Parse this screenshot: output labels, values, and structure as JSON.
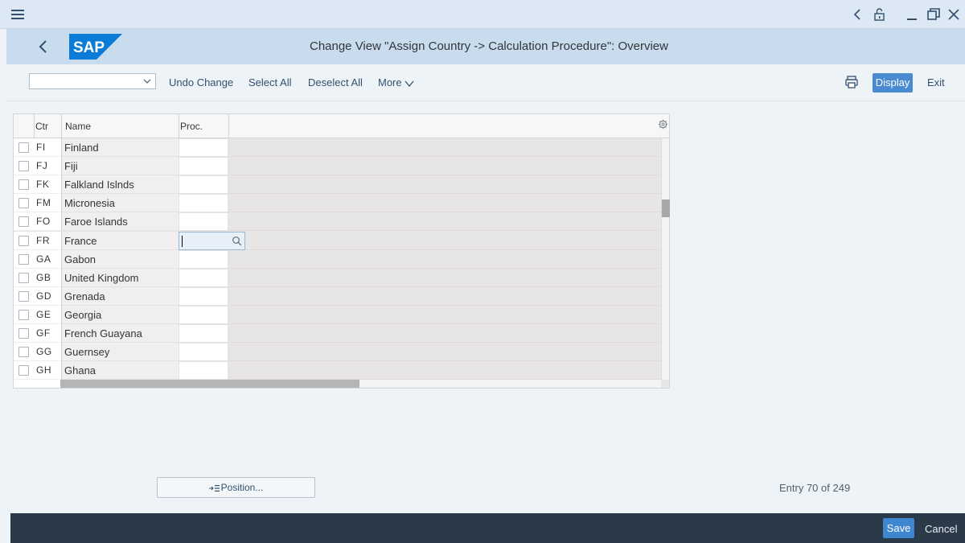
{
  "window": {
    "title": "Change View \"Assign Country -> Calculation Procedure\": Overview"
  },
  "brand": {
    "logo_text": "SAP",
    "logo_color": "#0a7bd6"
  },
  "colors": {
    "display_button": "#4a8ad0",
    "save_button": "#3f86d0",
    "footer": "#2b3a48",
    "title_bar": "#c8dcee"
  },
  "toolbar": {
    "select_value": "",
    "undo_change": "Undo Change",
    "select_all": "Select All",
    "deselect_all": "Deselect All",
    "more": "More",
    "display": "Display",
    "exit": "Exit"
  },
  "table": {
    "headers": {
      "ctr": "Ctr",
      "name": "Name",
      "proc": "Proc."
    },
    "rows": [
      {
        "ctr": "FI",
        "name": "Finland",
        "proc": ""
      },
      {
        "ctr": "FJ",
        "name": "Fiji",
        "proc": ""
      },
      {
        "ctr": "FK",
        "name": "Falkland Islnds",
        "proc": ""
      },
      {
        "ctr": "FM",
        "name": "Micronesia",
        "proc": ""
      },
      {
        "ctr": "FO",
        "name": "Faroe Islands",
        "proc": ""
      },
      {
        "ctr": "FR",
        "name": "France",
        "proc": "",
        "active": true
      },
      {
        "ctr": "GA",
        "name": "Gabon",
        "proc": ""
      },
      {
        "ctr": "GB",
        "name": "United Kingdom",
        "proc": ""
      },
      {
        "ctr": "GD",
        "name": "Grenada",
        "proc": ""
      },
      {
        "ctr": "GE",
        "name": "Georgia",
        "proc": ""
      },
      {
        "ctr": "GF",
        "name": "French Guayana",
        "proc": ""
      },
      {
        "ctr": "GG",
        "name": "Guernsey",
        "proc": ""
      },
      {
        "ctr": "GH",
        "name": "Ghana",
        "proc": ""
      }
    ]
  },
  "position_button": "Position...",
  "entry_info": "Entry 70 of 249",
  "footer": {
    "save": "Save",
    "cancel": "Cancel"
  },
  "icons": {
    "menu": "hamburger-icon",
    "nav_back": "chevron-left-icon",
    "lock": "unlock-icon",
    "minimize": "minimize-icon",
    "restore": "restore-icon",
    "close": "close-icon",
    "print": "printer-icon",
    "settings": "gear-icon",
    "value_help": "search-icon"
  }
}
